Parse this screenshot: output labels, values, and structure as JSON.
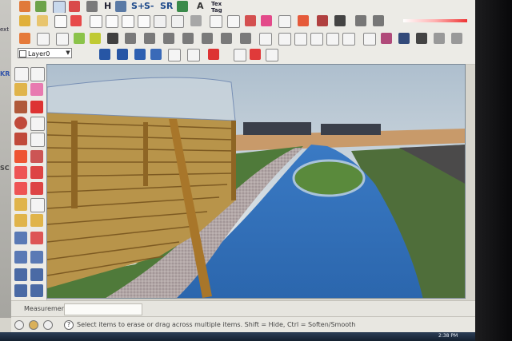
{
  "toolbar": {
    "sandbox_labels": [
      "S+",
      "S-",
      "SR"
    ],
    "label_h": "H",
    "label_text_tool": "A",
    "label_tag": "Tag",
    "label_text_top": "Tex"
  },
  "layer": {
    "selected": "Layer0"
  },
  "vcb": {
    "label": "Measurements",
    "value": ""
  },
  "status": {
    "hint": "Select items to erase or drag across multiple items. Shift = Hide, Ctrl = Soften/Smooth"
  },
  "left_edge": {
    "text_top": "ext",
    "text_mid": "KR",
    "text_low": "SC"
  },
  "taskbar": {
    "clock": "2:38 PM"
  },
  "icons": {
    "eraser": "eraser-icon",
    "select": "select-arrow-icon",
    "paint": "paint-bucket-icon"
  },
  "colors": {
    "ui_bg": "#ecebe6",
    "sky": "#9fb3c4",
    "water": "#2f6fb5",
    "grass": "#4d7a3a",
    "gravel": "#b3a8a6",
    "timber": "#b98c3a"
  }
}
